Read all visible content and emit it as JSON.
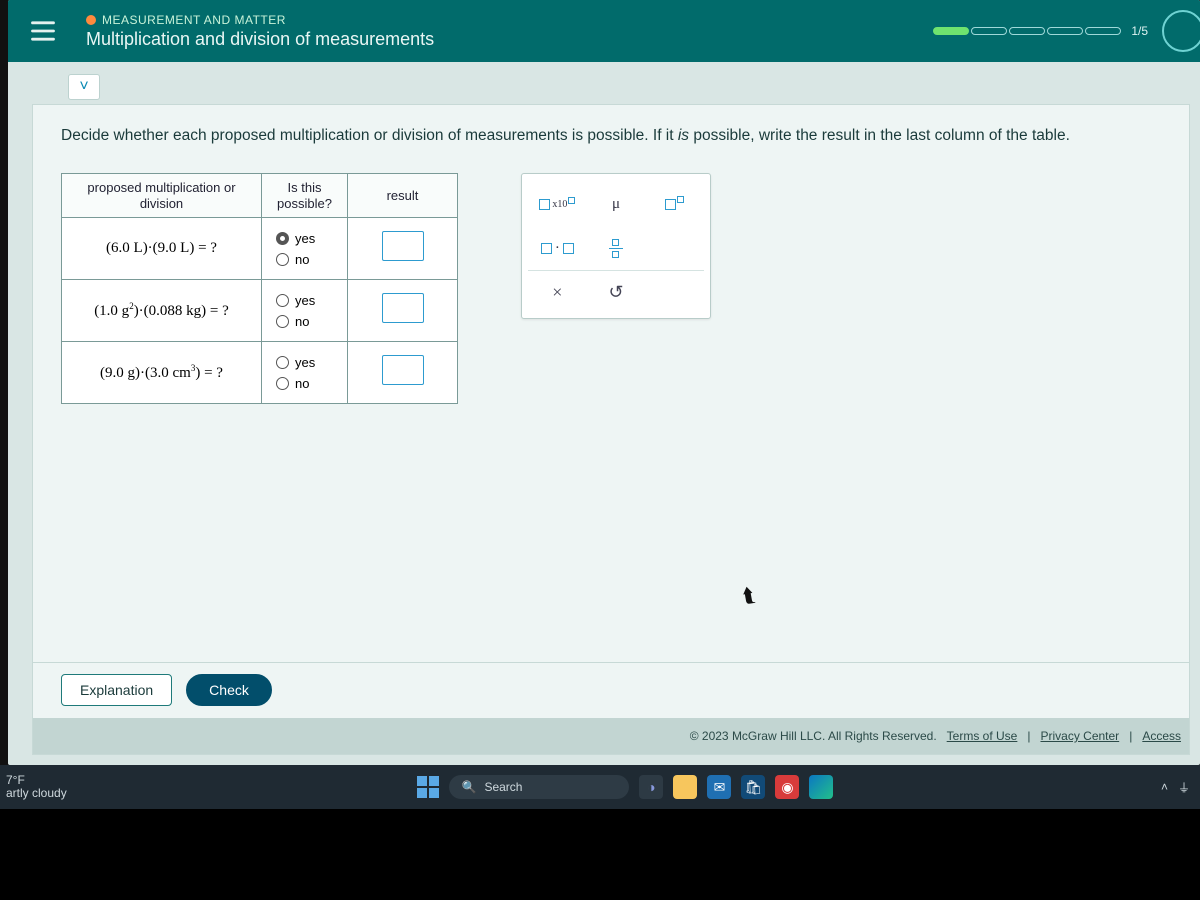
{
  "header": {
    "breadcrumb": "MEASUREMENT AND MATTER",
    "title": "Multiplication and division of measurements",
    "progress_label": "1/5"
  },
  "prompt": {
    "pre": "Decide whether each proposed multiplication or division of measurements is possible. If it ",
    "italic": "is",
    "post": " possible, write the result in the last column of the table."
  },
  "table": {
    "headers": {
      "expr": "proposed multiplication or division",
      "possible": "Is this possible?",
      "result": "result"
    },
    "option_yes": "yes",
    "option_no": "no",
    "rows": [
      {
        "expr_html": "(6.0 L)·(9.0 L) = ?",
        "yes_selected": true
      },
      {
        "expr_html": "(1.0 g²)·(0.088 kg) = ?",
        "yes_selected": false
      },
      {
        "expr_html": "(9.0 g)·(3.0 cm³) = ?",
        "yes_selected": false
      }
    ]
  },
  "palette": {
    "mu": "μ",
    "close": "×",
    "undo": "↺"
  },
  "buttons": {
    "explanation": "Explanation",
    "check": "Check"
  },
  "footer": {
    "copyright": "© 2023 McGraw Hill LLC. All Rights Reserved.",
    "terms": "Terms of Use",
    "privacy": "Privacy Center",
    "access": "Access"
  },
  "taskbar": {
    "temp": "7°F",
    "weather": "artly cloudy",
    "search": "Search"
  }
}
